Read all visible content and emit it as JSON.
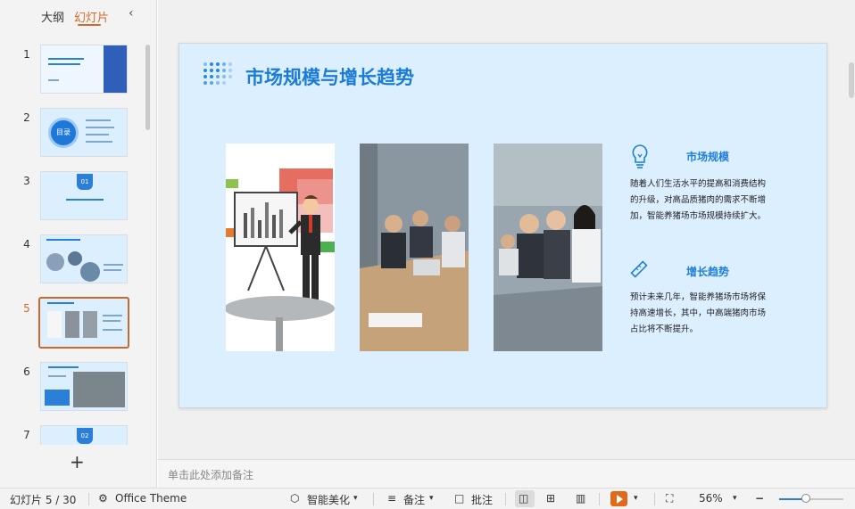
{
  "panel": {
    "tab_outline": "大纲",
    "tab_slides": "幻灯片",
    "thumbnails": [
      {
        "num": "1"
      },
      {
        "num": "2",
        "label": "目录"
      },
      {
        "num": "3",
        "badge": "01"
      },
      {
        "num": "4"
      },
      {
        "num": "5"
      },
      {
        "num": "6"
      },
      {
        "num": "7",
        "badge": "02"
      }
    ],
    "active_index": 5
  },
  "slide": {
    "title": "市场规模与增长趋势",
    "features": [
      {
        "title": "市场规模",
        "text": "随着人们生活水平的提高和消费结构的升级，对高品质猪肉的需求不断增加，智能养猪场市场规模持续扩大。"
      },
      {
        "title": "增长趋势",
        "text": "预计未来几年，智能养猪场市场将保持高速增长，其中，中高端猪肉市场占比将不断提升。"
      }
    ]
  },
  "notes": {
    "placeholder": "单击此处添加备注"
  },
  "status": {
    "slide_counter": "幻灯片 5 / 30",
    "theme": "Office Theme",
    "beautify": "智能美化",
    "notes_btn": "备注",
    "comments_btn": "批注",
    "zoom": "56%",
    "zoom_fraction": 0.56
  },
  "colors": {
    "accent": "#d46b2c",
    "slide_bg": "#dcefff",
    "title_blue": "#1a7bd8"
  }
}
